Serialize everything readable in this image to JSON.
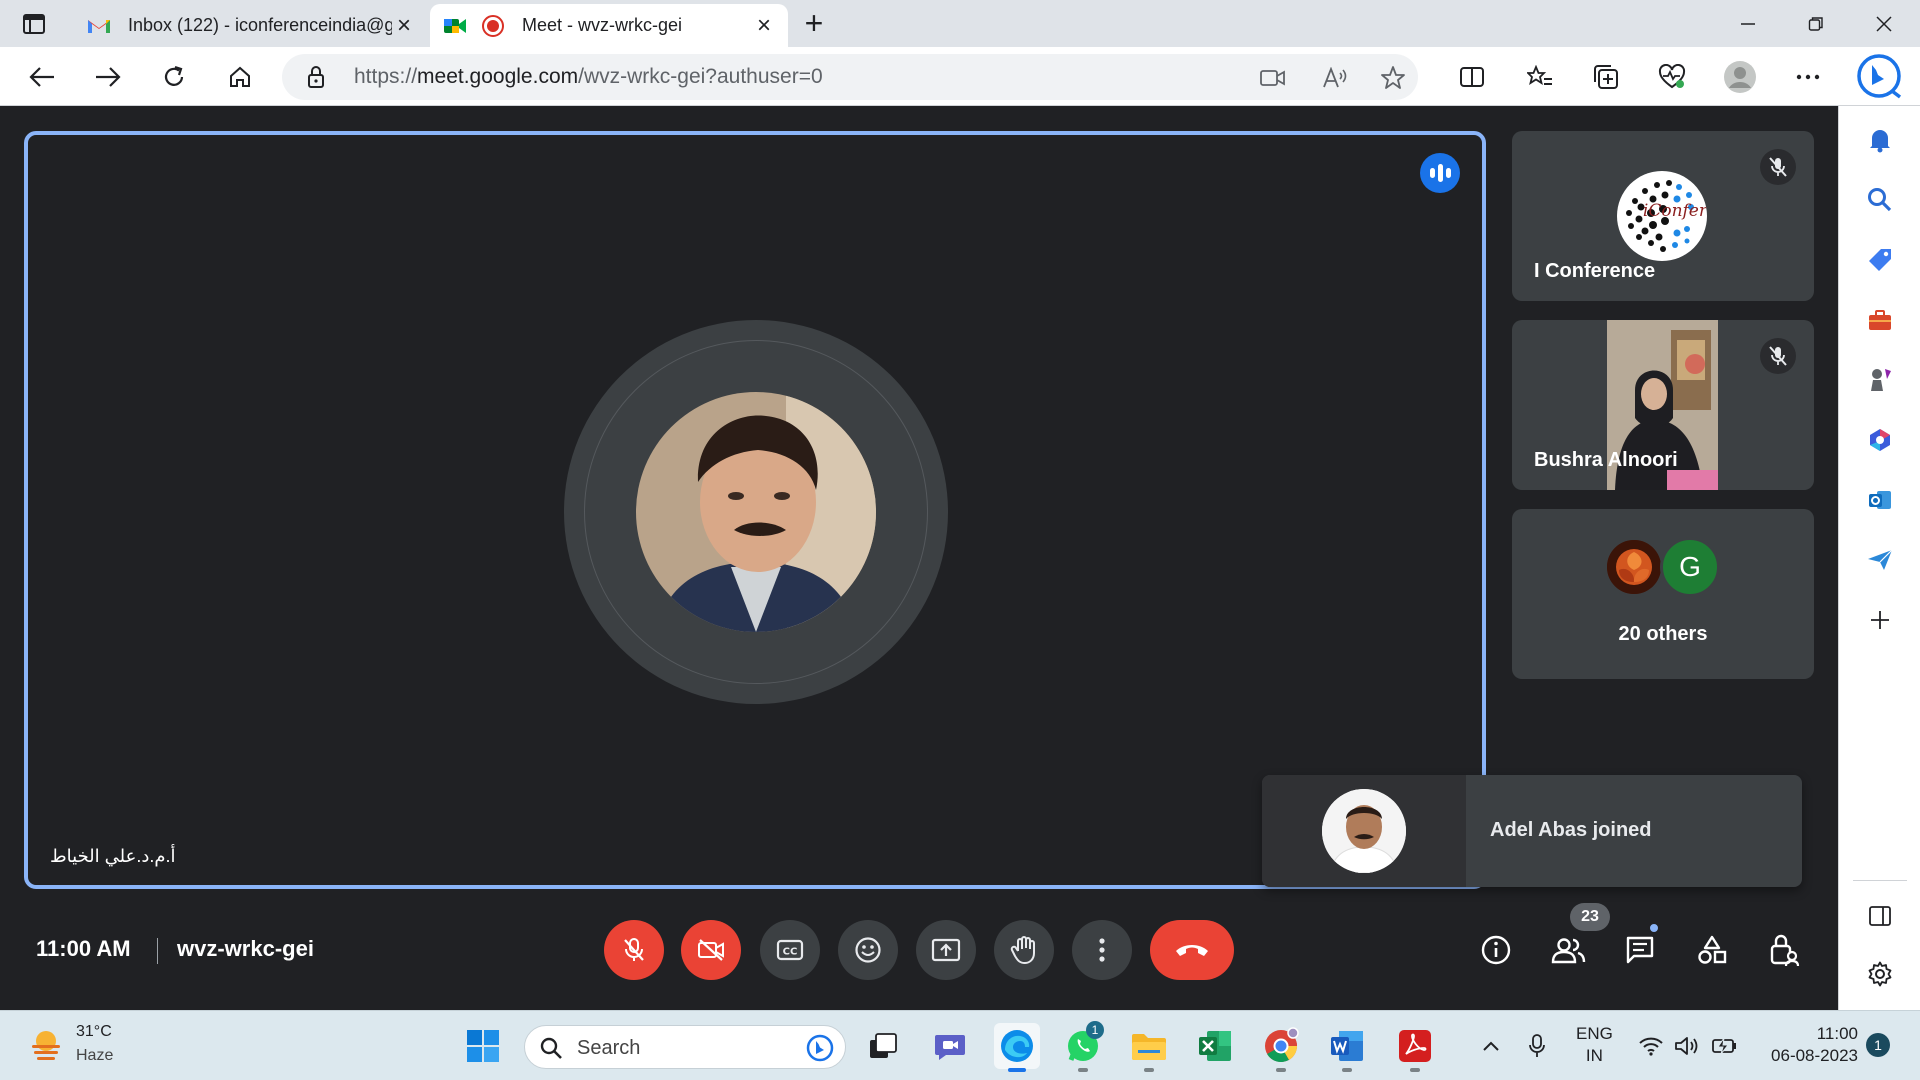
{
  "browser": {
    "tabs": [
      {
        "title": "Inbox (122) - iconferenceindia@g",
        "active": false,
        "icon": "gmail-icon"
      },
      {
        "title": "Meet - wvz-wrkc-gei",
        "active": true,
        "icon": "meet-icon"
      }
    ],
    "url_prefix": "https://",
    "url_host": "meet.google.com",
    "url_path": "/wvz-wrkc-gei?authuser=0",
    "new_tab_symbol": "+"
  },
  "meet": {
    "main_participant_name": "أ.م.د.علي الخياط",
    "participants": [
      {
        "name": "I Conference",
        "muted": true,
        "logo_text": "iConfer"
      },
      {
        "name": "Bushra Alnoori",
        "muted": true
      }
    ],
    "others": {
      "label": "20 others",
      "letter": "G",
      "letter_color": "#1e7e34"
    },
    "toast": {
      "message": "Adel Abas joined"
    },
    "time": "11:00 AM",
    "code": "wvz-wrkc-gei",
    "people_count": "23",
    "colors": {
      "accent": "#8ab4f8",
      "danger": "#ea4335",
      "tile": "#3c4043",
      "bg": "#202124"
    }
  },
  "taskbar": {
    "weather": {
      "temp": "31°C",
      "condition": "Haze"
    },
    "search_label": "Search",
    "whatsapp_badge": "1",
    "lang_top": "ENG",
    "lang_bottom": "IN",
    "time": "11:00",
    "date": "06-08-2023",
    "notifications": "1"
  }
}
